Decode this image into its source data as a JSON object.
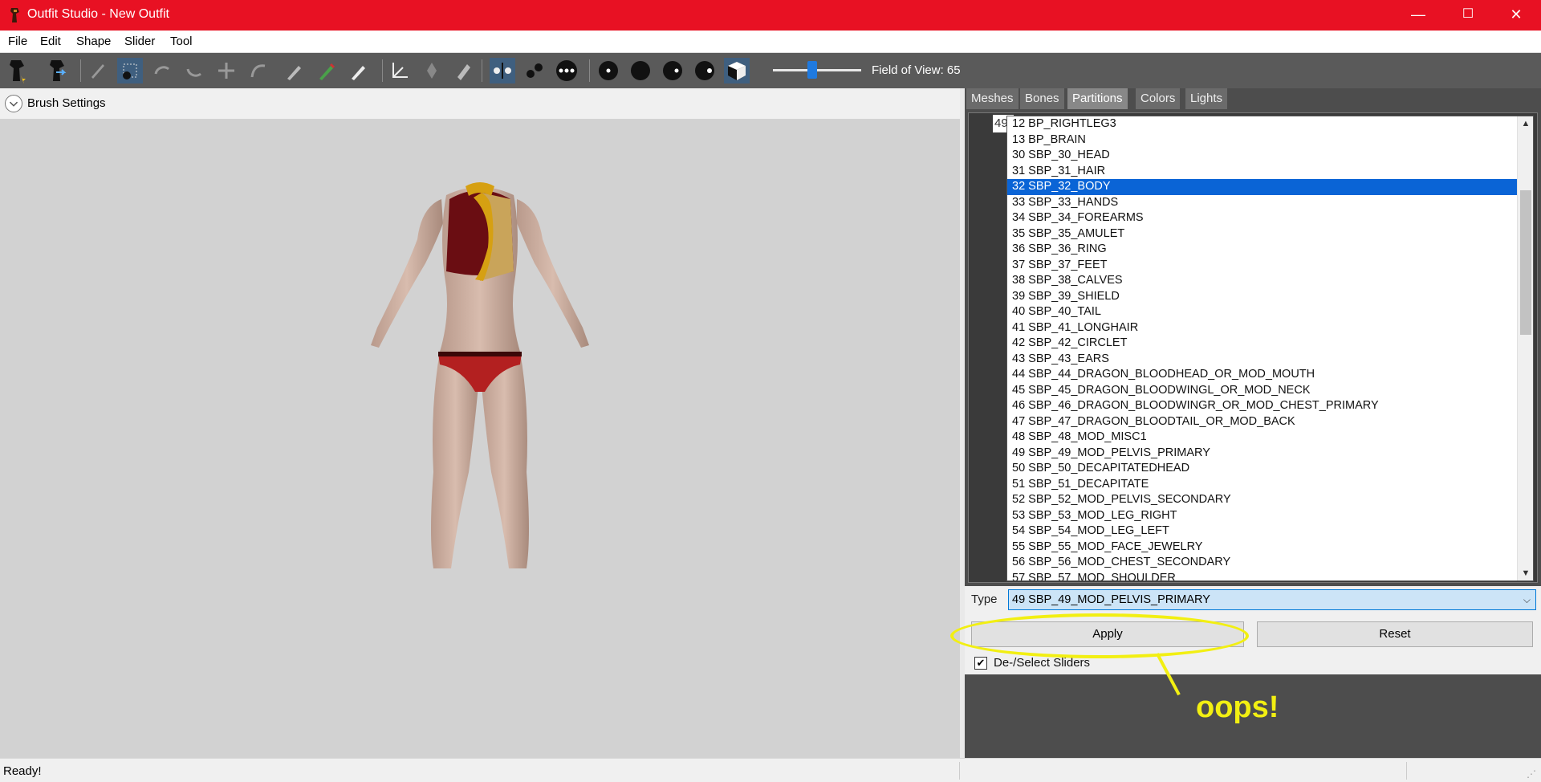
{
  "window": {
    "title": "Outfit Studio - New Outfit",
    "minimize": "—",
    "maximize": "☐",
    "close": "✕"
  },
  "menu": [
    "File",
    "Edit",
    "Shape",
    "Slider",
    "Tool"
  ],
  "toolbar": {
    "fov_label": "Field of View: 65",
    "fov_value": 65
  },
  "brush_settings": {
    "label": "Brush Settings"
  },
  "tabs": [
    "Meshes",
    "Bones",
    "Partitions",
    "Colors",
    "Lights"
  ],
  "active_tab": "Partitions",
  "partition_number": "49",
  "partition_list": [
    "12 BP_RIGHTLEG3",
    "13 BP_BRAIN",
    "30 SBP_30_HEAD",
    "31 SBP_31_HAIR",
    "32 SBP_32_BODY",
    "33 SBP_33_HANDS",
    "34 SBP_34_FOREARMS",
    "35 SBP_35_AMULET",
    "36 SBP_36_RING",
    "37 SBP_37_FEET",
    "38 SBP_38_CALVES",
    "39 SBP_39_SHIELD",
    "40 SBP_40_TAIL",
    "41 SBP_41_LONGHAIR",
    "42 SBP_42_CIRCLET",
    "43 SBP_43_EARS",
    "44 SBP_44_DRAGON_BLOODHEAD_OR_MOD_MOUTH",
    "45 SBP_45_DRAGON_BLOODWINGL_OR_MOD_NECK",
    "46 SBP_46_DRAGON_BLOODWINGR_OR_MOD_CHEST_PRIMARY",
    "47 SBP_47_DRAGON_BLOODTAIL_OR_MOD_BACK",
    "48 SBP_48_MOD_MISC1",
    "49 SBP_49_MOD_PELVIS_PRIMARY",
    "50 SBP_50_DECAPITATEDHEAD",
    "51 SBP_51_DECAPITATE",
    "52 SBP_52_MOD_PELVIS_SECONDARY",
    "53 SBP_53_MOD_LEG_RIGHT",
    "54 SBP_54_MOD_LEG_LEFT",
    "55 SBP_55_MOD_FACE_JEWELRY",
    "56 SBP_56_MOD_CHEST_SECONDARY",
    "57 SBP_57_MOD_SHOULDER"
  ],
  "selected_index": 4,
  "type": {
    "label": "Type",
    "value": "49 SBP_49_MOD_PELVIS_PRIMARY"
  },
  "buttons": {
    "apply": "Apply",
    "reset": "Reset"
  },
  "checkbox": {
    "label": "De-/Select Sliders",
    "checked": true,
    "mark": "✔"
  },
  "annotation": {
    "text": "oops!",
    "color": "#f2ef12"
  },
  "status": {
    "text": "Ready!"
  },
  "colors": {
    "titlebar": "#e81123",
    "selection": "#0a64d6",
    "panel": "#4d4d4d",
    "viewport": "#d2d2d2"
  }
}
